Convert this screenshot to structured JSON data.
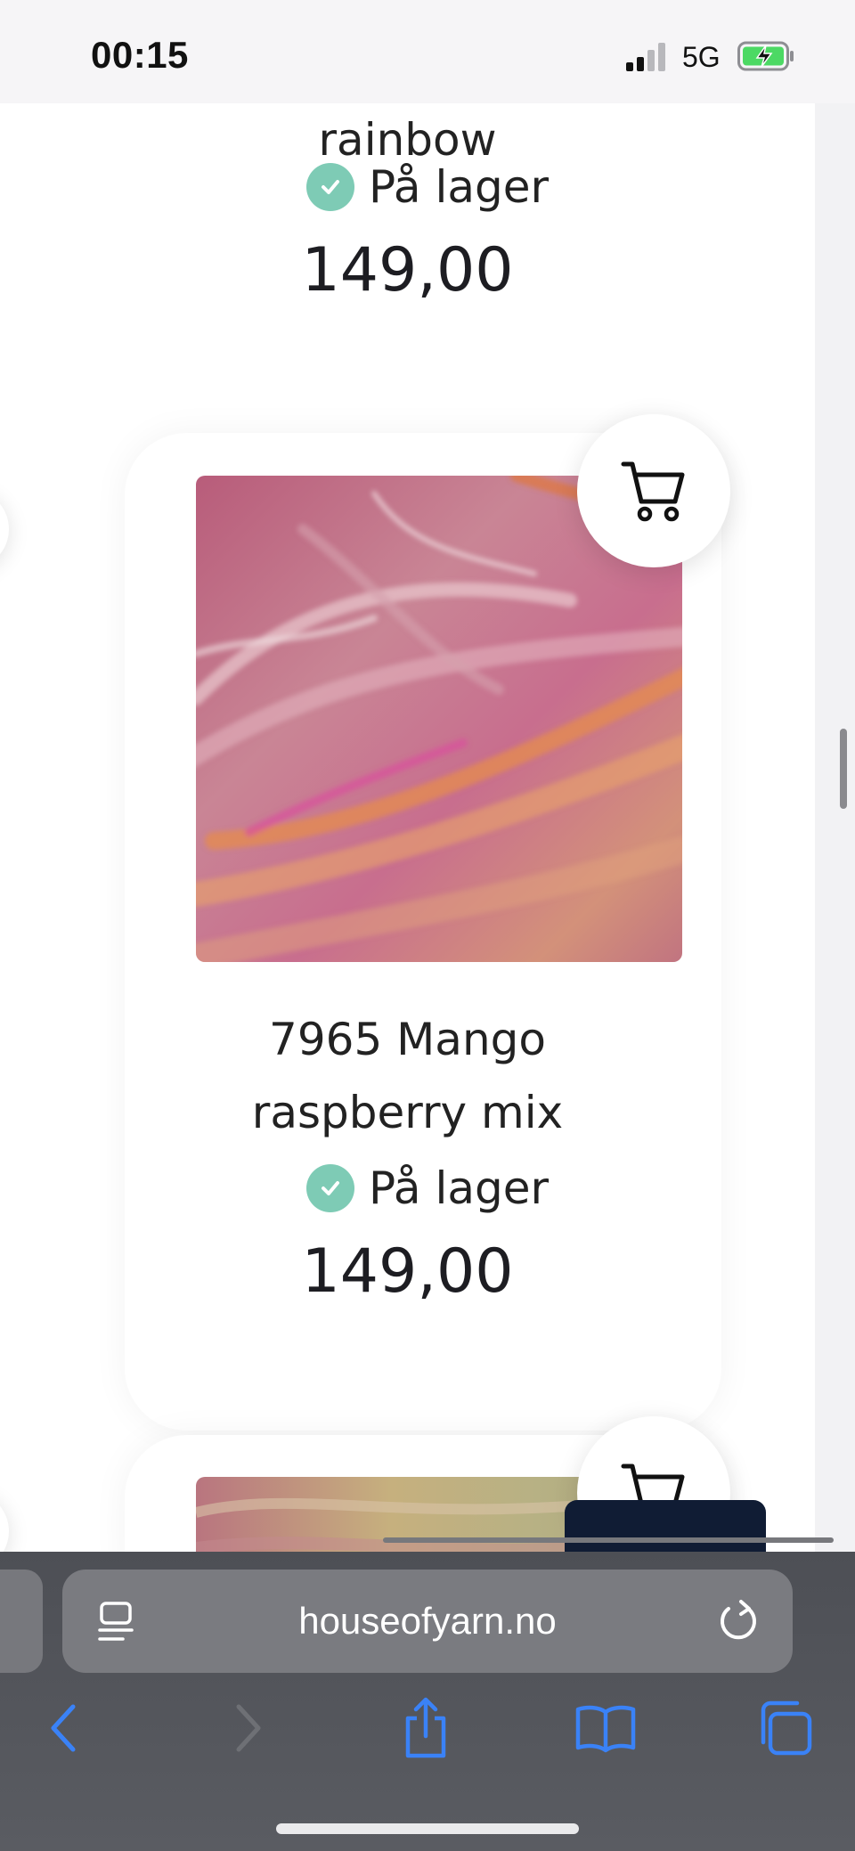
{
  "status_bar": {
    "time": "00:15",
    "network": "5G",
    "battery_state": "charging",
    "battery_color": "#4cd964"
  },
  "products": [
    {
      "title_lines": [
        "rainbow"
      ],
      "stock": "På lager",
      "price": "149,00"
    },
    {
      "title_lines": [
        "7965 Mango",
        "raspberry mix"
      ],
      "stock": "På lager",
      "price": "149,00",
      "image": "pink-orange-mohair-yarn"
    },
    {
      "image": "multicolor-yarn"
    }
  ],
  "icons": {
    "cart": "cart-icon",
    "stock": "check-circle-icon"
  },
  "browser": {
    "url": "houseofyarn.no",
    "buttons": [
      "back",
      "forward",
      "share",
      "bookmarks",
      "tabs"
    ]
  },
  "colors": {
    "stock_green": "#7ecbb5",
    "safari_blue": "#3a82f7",
    "toolbar": "#55575c"
  }
}
